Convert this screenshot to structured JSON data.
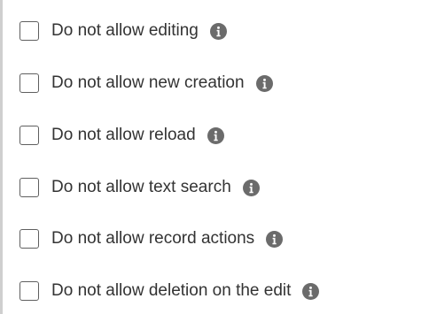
{
  "options": [
    {
      "label": "Do not allow editing",
      "checked": false,
      "icon": "info-icon"
    },
    {
      "label": "Do not allow new creation",
      "checked": false,
      "icon": "info-icon"
    },
    {
      "label": "Do not allow reload",
      "checked": false,
      "icon": "info-icon"
    },
    {
      "label": "Do not allow text search",
      "checked": false,
      "icon": "info-icon"
    },
    {
      "label": "Do not allow record actions",
      "checked": false,
      "icon": "info-icon"
    },
    {
      "label": "Do not allow deletion on the edit",
      "checked": false,
      "icon": "info-icon"
    }
  ],
  "colors": {
    "checkbox_border": "#5f5f5f",
    "label_text": "#333333",
    "info_icon": "#6b6b6b",
    "left_rule": "#cfcfcf"
  }
}
